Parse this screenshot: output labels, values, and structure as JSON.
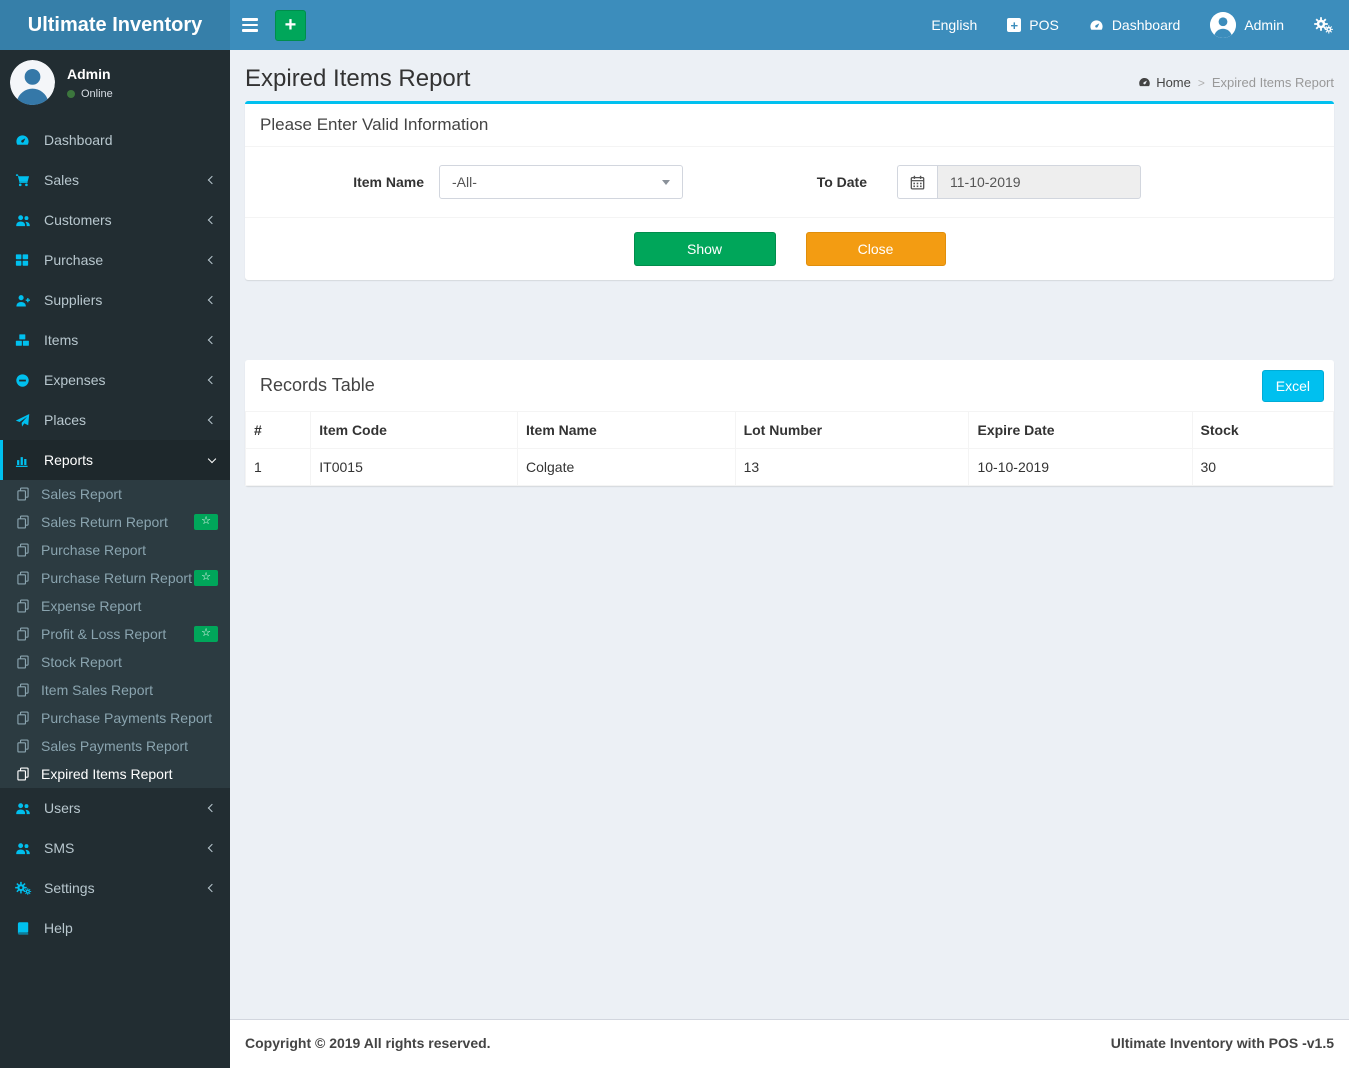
{
  "topbar": {
    "brand": "Ultimate Inventory",
    "nav": {
      "english": "English",
      "pos": "POS",
      "dashboard": "Dashboard",
      "user": "Admin"
    }
  },
  "sidebar": {
    "user": {
      "name": "Admin",
      "status": "Online"
    },
    "menu": [
      {
        "label": "Dashboard"
      },
      {
        "label": "Sales"
      },
      {
        "label": "Customers"
      },
      {
        "label": "Purchase"
      },
      {
        "label": "Suppliers"
      },
      {
        "label": "Items"
      },
      {
        "label": "Expenses"
      },
      {
        "label": "Places"
      },
      {
        "label": "Reports"
      },
      {
        "label": "Users"
      },
      {
        "label": "SMS"
      },
      {
        "label": "Settings"
      },
      {
        "label": "Help"
      }
    ],
    "reports_submenu": [
      {
        "label": "Sales Report"
      },
      {
        "label": "Sales Return Report",
        "badge": "☆"
      },
      {
        "label": "Purchase Report"
      },
      {
        "label": "Purchase Return Report",
        "badge": "☆"
      },
      {
        "label": "Expense Report"
      },
      {
        "label": "Profit & Loss Report",
        "badge": "☆"
      },
      {
        "label": "Stock Report"
      },
      {
        "label": "Item Sales Report"
      },
      {
        "label": "Purchase Payments Report"
      },
      {
        "label": "Sales Payments Report"
      },
      {
        "label": "Expired Items Report"
      }
    ]
  },
  "page": {
    "title": "Expired Items Report",
    "breadcrumb": {
      "home": "Home",
      "current": "Expired Items Report"
    }
  },
  "filter": {
    "title": "Please Enter Valid Information",
    "item_name": {
      "label": "Item Name",
      "value": "-All-"
    },
    "to_date": {
      "label": "To Date",
      "value": "11-10-2019"
    },
    "show": "Show",
    "close": "Close"
  },
  "records": {
    "title": "Records Table",
    "excel": "Excel",
    "columns": [
      "#",
      "Item Code",
      "Item Name",
      "Lot Number",
      "Expire Date",
      "Stock"
    ],
    "rows": [
      {
        "num": "1",
        "item_code": "IT0015",
        "item_name": "Colgate",
        "lot_number": "13",
        "expire_date": "10-10-2019",
        "stock": "30"
      }
    ]
  },
  "footer": {
    "left": "Copyright © 2019 All rights reserved.",
    "right": "Ultimate Inventory with POS -v1.5"
  },
  "colors": {
    "navbar": "#3c8dbc",
    "logo_bg": "#367fa9",
    "sidebar_bg": "#222d32",
    "submenu_bg": "#2c3b41",
    "accent_cyan": "#00c0ef",
    "success_green": "#00a65a",
    "warning_orange": "#f39c12",
    "content_bg": "#ecf0f5",
    "online_green": "#3c763d"
  }
}
